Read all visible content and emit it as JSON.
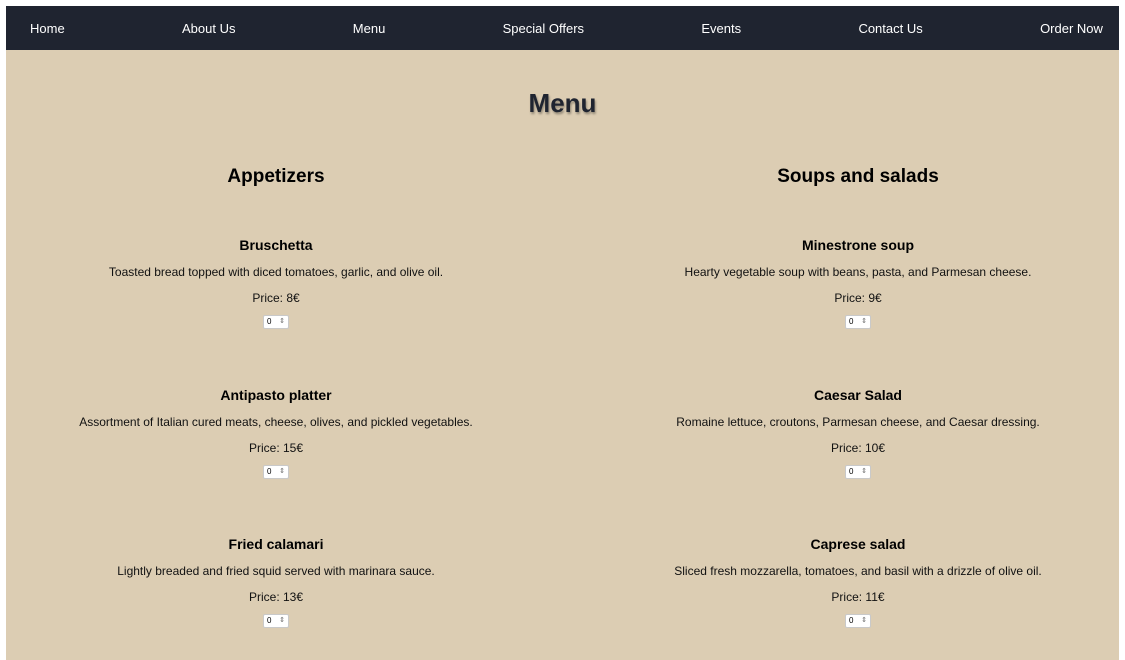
{
  "nav": {
    "items": [
      {
        "label": "Home"
      },
      {
        "label": "About Us"
      },
      {
        "label": "Menu"
      },
      {
        "label": "Special Offers"
      },
      {
        "label": "Events"
      },
      {
        "label": "Contact Us"
      },
      {
        "label": "Order Now"
      }
    ]
  },
  "page": {
    "title": "Menu"
  },
  "categories": [
    {
      "title": "Appetizers",
      "items": [
        {
          "name": "Bruschetta",
          "description": "Toasted bread topped with diced tomatoes, garlic, and olive oil.",
          "price": "Price: 8€",
          "quantity": "0"
        },
        {
          "name": "Antipasto platter",
          "description": "Assortment of Italian cured meats, cheese, olives, and pickled vegetables.",
          "price": "Price: 15€",
          "quantity": "0"
        },
        {
          "name": "Fried calamari",
          "description": "Lightly breaded and fried squid served with marinara sauce.",
          "price": "Price: 13€",
          "quantity": "0"
        }
      ]
    },
    {
      "title": "Soups and salads",
      "items": [
        {
          "name": "Minestrone soup",
          "description": "Hearty vegetable soup with beans, pasta, and Parmesan cheese.",
          "price": "Price: 9€",
          "quantity": "0"
        },
        {
          "name": "Caesar Salad",
          "description": "Romaine lettuce, croutons, Parmesan cheese, and Caesar dressing.",
          "price": "Price: 10€",
          "quantity": "0"
        },
        {
          "name": "Caprese salad",
          "description": "Sliced fresh mozzarella, tomatoes, and basil with a drizzle of olive oil.",
          "price": "Price: 11€",
          "quantity": "0"
        }
      ]
    }
  ],
  "icons": {
    "stepper": "up-down-arrows-icon"
  },
  "colors": {
    "nav_background": "#1f2430",
    "page_background": "#dccdb3",
    "title_color": "#1f2430"
  }
}
